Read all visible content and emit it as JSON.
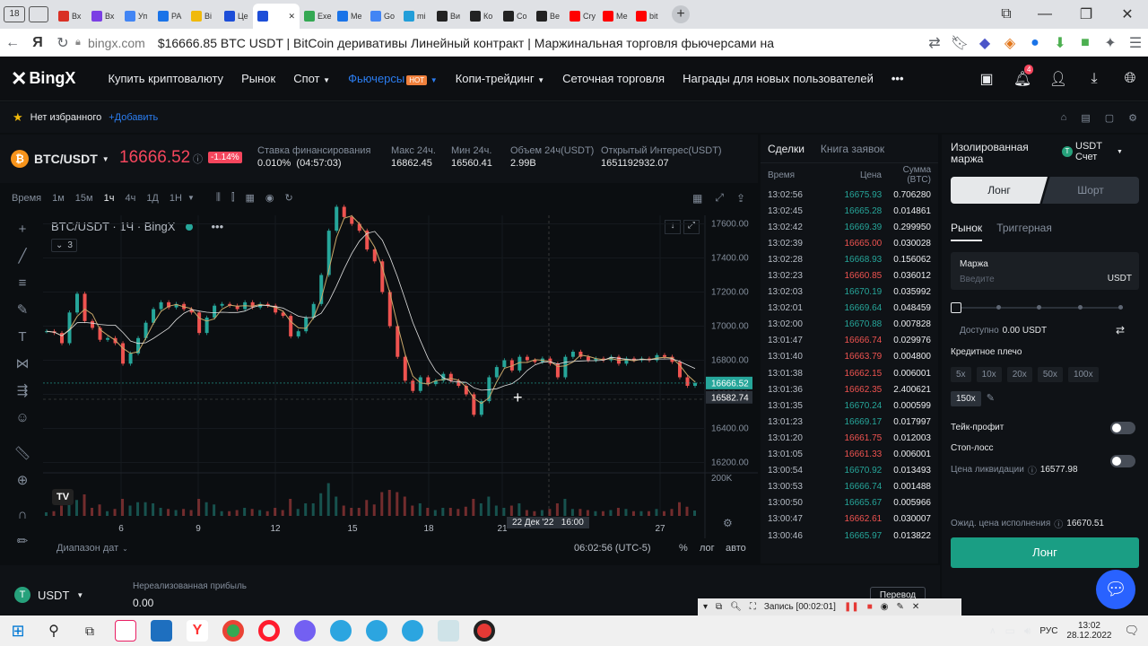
{
  "browser": {
    "tabs": [
      {
        "label": "Вх",
        "color": "#d93025"
      },
      {
        "label": "Вх",
        "color": "#7b3fe4"
      },
      {
        "label": "Уп",
        "color": "#4285f4"
      },
      {
        "label": "PA",
        "color": "#1a73e8"
      },
      {
        "label": "Bi",
        "color": "#f0b90b"
      },
      {
        "label": "Це",
        "color": "#1d4ed8"
      },
      {
        "label": "",
        "color": "#1d4ed8"
      },
      {
        "label": "Exe",
        "color": "#34a853"
      },
      {
        "label": "Me",
        "color": "#1a73e8"
      },
      {
        "label": "Go",
        "color": "#4285f4"
      },
      {
        "label": "mi",
        "color": "#229ed9"
      },
      {
        "label": "Ви",
        "color": "#222222"
      },
      {
        "label": "Ко",
        "color": "#222222"
      },
      {
        "label": "Со",
        "color": "#222222"
      },
      {
        "label": "Ве",
        "color": "#222222"
      },
      {
        "label": "Cry",
        "color": "#ff0000"
      },
      {
        "label": "Ме",
        "color": "#ff0000"
      },
      {
        "label": "bit",
        "color": "#ff0000"
      }
    ],
    "window_badge": "18",
    "domain": "bingx.com",
    "page_title": "$16666.85 BTC USDT | BitCoin деривативы Линейный контракт | Маржинальная торговля фьючерсами на Bin..."
  },
  "nav": {
    "logo": "BingX",
    "items": [
      "Купить криптовалюту",
      "Рынок",
      "Спот",
      "Фьючерсы",
      "Копи-трейдинг",
      "Сеточная торговля",
      "Награды для новых пользователей"
    ],
    "hot_badge": "HOT",
    "more": "•••",
    "notif_count": "4",
    "active_color": "#2b7df0"
  },
  "favbar": {
    "empty": "Нет избранного",
    "add": "+Добавить"
  },
  "ticker": {
    "pair": "BTC/USDT",
    "price": "16666.52",
    "change": "-1.14%",
    "stats": [
      {
        "label": "Ставка финансирования",
        "value": "0.010%  (04:57:03)"
      },
      {
        "label": "Макс 24ч.",
        "value": "16862.45"
      },
      {
        "label": "Мин 24ч.",
        "value": "16560.41"
      },
      {
        "label": "Объем 24ч(USDT)",
        "value": "2.99B"
      },
      {
        "label": "Открытый Интерес(USDT)",
        "value": "1651192932.07"
      }
    ]
  },
  "toolbar": {
    "time": "Время",
    "intervals": [
      "1м",
      "15м",
      "1ч",
      "4ч",
      "1Д",
      "1Н"
    ],
    "selected": "1ч"
  },
  "chart": {
    "legend": "BTC/USDT · 1Ч · BingX",
    "collapse_count": "3",
    "date_range": "Диапазон дат",
    "clock": "06:02:56 (UTC-5)",
    "pct": "%",
    "log": "лог",
    "auto": "авто",
    "crosshair_label": "22 Дек '22   16:00",
    "volume_label": "200K"
  },
  "chart_data": {
    "type": "line",
    "title": "BTC/USDT · 1Ч · BingX",
    "x_ticks": [
      "6",
      "9",
      "12",
      "15",
      "18",
      "21",
      "27"
    ],
    "y_ticks": [
      "17600.00",
      "17400.00",
      "17200.00",
      "17000.00",
      "16800.00",
      "16600.00",
      "16400.00",
      "16200.00"
    ],
    "ylim": [
      16150,
      17650
    ],
    "series": [
      {
        "name": "",
        "values": [
          16970,
          16960,
          16900,
          17080,
          17190,
          17030,
          16990,
          16920,
          16930,
          16900,
          16780,
          16840,
          16930,
          17020,
          17100,
          17140,
          17110,
          17130,
          17100,
          17080,
          16960,
          17050,
          17120,
          17130,
          17120,
          17100,
          17140,
          17110,
          17130,
          17120,
          17080,
          17060,
          16940,
          16970,
          17050,
          17130,
          17300,
          17560,
          17700,
          17640,
          17600,
          17560,
          17450,
          17380,
          17200,
          17000,
          16820,
          16680,
          16620,
          16700,
          16660,
          16680,
          16720,
          16680,
          16650,
          16600,
          16480,
          16560,
          16700,
          16760,
          16800,
          16740,
          16820,
          16800,
          16790,
          16810,
          16780,
          16700,
          16820,
          16850,
          16820,
          16800,
          16810,
          16800,
          16820,
          16780,
          16810,
          16800,
          16810,
          16800,
          16830,
          16820,
          16790,
          16700,
          16650,
          16666
        ]
      }
    ],
    "price_tags": [
      {
        "value": "16666.52",
        "color": "#26a69a"
      },
      {
        "value": "16582.74",
        "color": "#2b3139"
      }
    ],
    "grid": true,
    "legend_placement": "top-left"
  },
  "trades": {
    "tabs": [
      "Сделки",
      "Книга заявок"
    ],
    "headers": [
      "Время",
      "Цена",
      "Сумма (BTC)"
    ],
    "rows": [
      [
        "13:02:56",
        "16675.93",
        "0.706280",
        "up"
      ],
      [
        "13:02:45",
        "16665.28",
        "0.014861",
        "up"
      ],
      [
        "13:02:42",
        "16669.39",
        "0.299950",
        "up"
      ],
      [
        "13:02:39",
        "16665.00",
        "0.030028",
        "down"
      ],
      [
        "13:02:28",
        "16668.93",
        "0.156062",
        "up"
      ],
      [
        "13:02:23",
        "16660.85",
        "0.036012",
        "down"
      ],
      [
        "13:02:03",
        "16670.19",
        "0.035992",
        "up"
      ],
      [
        "13:02:01",
        "16669.64",
        "0.048459",
        "up"
      ],
      [
        "13:02:00",
        "16670.88",
        "0.007828",
        "up"
      ],
      [
        "13:01:47",
        "16666.74",
        "0.029976",
        "down"
      ],
      [
        "13:01:40",
        "16663.79",
        "0.004800",
        "down"
      ],
      [
        "13:01:38",
        "16662.15",
        "0.006001",
        "down"
      ],
      [
        "13:01:36",
        "16662.35",
        "2.400621",
        "down"
      ],
      [
        "13:01:35",
        "16670.24",
        "0.000599",
        "up"
      ],
      [
        "13:01:23",
        "16669.17",
        "0.017997",
        "up"
      ],
      [
        "13:01:20",
        "16661.75",
        "0.012003",
        "down"
      ],
      [
        "13:01:05",
        "16661.33",
        "0.006001",
        "down"
      ],
      [
        "13:00:54",
        "16670.92",
        "0.013493",
        "up"
      ],
      [
        "13:00:53",
        "16666.74",
        "0.001488",
        "up"
      ],
      [
        "13:00:50",
        "16665.67",
        "0.005966",
        "up"
      ],
      [
        "13:00:47",
        "16662.61",
        "0.030007",
        "down"
      ],
      [
        "13:00:46",
        "16665.97",
        "0.013822",
        "up"
      ]
    ],
    "up_color": "#26a69a",
    "down_color": "#ef5350"
  },
  "order": {
    "margin_mode": "Изолированная маржа",
    "account_coin": "USDT",
    "account_label": "Счет",
    "long": "Лонг",
    "short": "Шорт",
    "tabs": [
      "Рынок",
      "Триггерная"
    ],
    "margin_label": "Маржа",
    "margin_placeholder": "Введите",
    "margin_unit": "USDT",
    "available_label": "Доступно",
    "available_value": "0.00 USDT",
    "leverage_label": "Кредитное плечо",
    "leverages": [
      "5x",
      "10x",
      "20x",
      "50x",
      "100x",
      "150x"
    ],
    "leverage_selected": "150x",
    "take_profit": "Тейк-профит",
    "stop_loss": "Стоп-лосс",
    "liq_label": "Цена ликвидации",
    "liq_value": "16577.98",
    "exec_label": "Ожид. цена исполнения",
    "exec_value": "16670.51",
    "submit": "Лонг",
    "accent": "#1a9e84"
  },
  "bottom": {
    "currency": "USDT",
    "pnl_label": "Нереализованная прибыль",
    "pnl_value": "0.00",
    "transfer": "Перевод"
  },
  "recorder": {
    "label": "Запись [00:02:01]"
  },
  "taskbar": {
    "lang": "РУС",
    "time": "13:02",
    "date": "28.12.2022"
  }
}
